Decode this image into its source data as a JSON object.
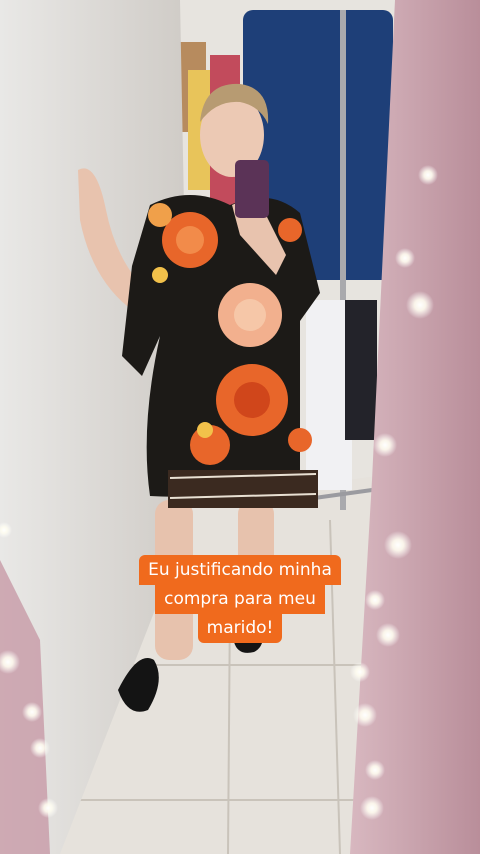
{
  "caption": {
    "lines": [
      "Eu justificando minha",
      "compra para meu",
      "marido!"
    ]
  },
  "colors": {
    "caption_bg": "#f06a1d",
    "caption_text": "#ffffff",
    "dress_base": "#1c1a17",
    "flower_orange": "#e8662a",
    "flower_peach": "#f2b08e",
    "blue_garment": "#1e3f78",
    "pink_wall": "#c9a3ad",
    "floor_tile": "#e6e2dc"
  },
  "icons": [
    "string-lights-icon",
    "smartphone-icon"
  ]
}
